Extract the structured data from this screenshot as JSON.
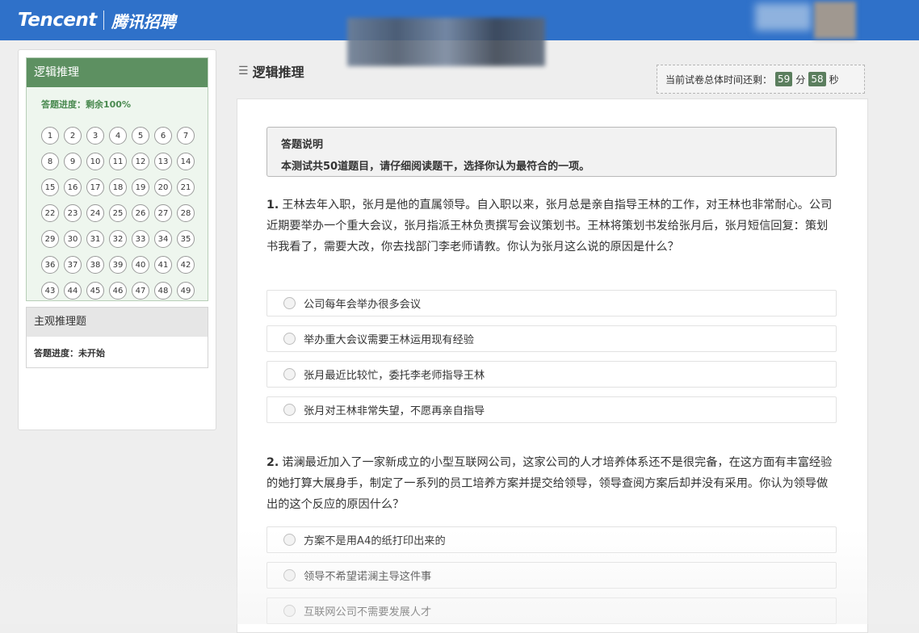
{
  "header": {
    "brand_en": "Tencent",
    "brand_cn": "腾讯招聘"
  },
  "sidebar": {
    "section1": {
      "title": "逻辑推理",
      "progress": "答题进度：剩余100%",
      "numbers": [
        "1",
        "2",
        "3",
        "4",
        "5",
        "6",
        "7",
        "8",
        "9",
        "10",
        "11",
        "12",
        "13",
        "14",
        "15",
        "16",
        "17",
        "18",
        "19",
        "20",
        "21",
        "22",
        "23",
        "24",
        "25",
        "26",
        "27",
        "28",
        "29",
        "30",
        "31",
        "32",
        "33",
        "34",
        "35",
        "36",
        "37",
        "38",
        "39",
        "40",
        "41",
        "42",
        "43",
        "44",
        "45",
        "46",
        "47",
        "48",
        "49"
      ]
    },
    "section2": {
      "title": "主观推理题",
      "progress": "答题进度：未开始"
    }
  },
  "main": {
    "title": "逻辑推理",
    "timer": {
      "label": "当前试卷总体时间还剩：",
      "minutes": "59",
      "min_unit": "分",
      "seconds": "58",
      "sec_unit": "秒"
    },
    "instructions": {
      "heading": "答题说明",
      "body": "本测试共50道题目，请仔细阅读题干，选择你认为最符合的一项。"
    },
    "questions": [
      {
        "num": "1.",
        "text": "王林去年入职，张月是他的直属领导。自入职以来，张月总是亲自指导王林的工作，对王林也非常耐心。公司近期要举办一个重大会议，张月指派王林负责撰写会议策划书。王林将策划书发给张月后，张月短信回复：策划书我看了，需要大改，你去找部门李老师请教。你认为张月这么说的原因是什么？",
        "options": [
          "公司每年会举办很多会议",
          "举办重大会议需要王林运用现有经验",
          "张月最近比较忙，委托李老师指导王林",
          "张月对王林非常失望，不愿再亲自指导"
        ]
      },
      {
        "num": "2.",
        "text": "诺澜最近加入了一家新成立的小型互联网公司，这家公司的人才培养体系还不是很完备，在这方面有丰富经验的她打算大展身手，制定了一系列的员工培养方案并提交给领导，领导查阅方案后却并没有采用。你认为领导做出的这个反应的原因什么？",
        "options": [
          "方案不是用A4的纸打印出来的",
          "领导不希望诺澜主导这件事",
          "互联网公司不需要发展人才"
        ]
      }
    ]
  }
}
